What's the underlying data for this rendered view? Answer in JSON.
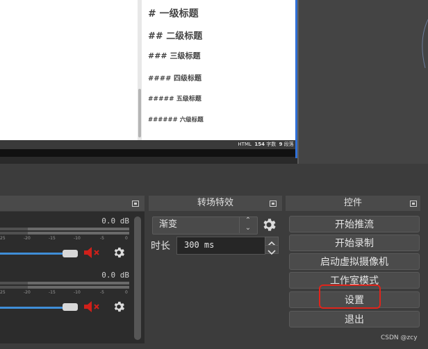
{
  "preview": {
    "headings": [
      "# 一级标题",
      "## 二级标题",
      "### 三级标题",
      "#### 四级标题",
      "##### 五级标题",
      "###### 六级标题"
    ],
    "status": {
      "format": "HTML",
      "char_count": "154",
      "char_label": "字数",
      "para_count": "9",
      "para_label": "段落"
    }
  },
  "mixer": {
    "channels": [
      {
        "db": "0.0 dB",
        "volume": 1.0
      },
      {
        "db": "0.0 dB",
        "volume": 1.0
      }
    ],
    "scale_ticks": [
      "25",
      "-20",
      "-15",
      "-10",
      "-5",
      "0"
    ]
  },
  "transitions": {
    "title": "转场特效",
    "selected": "渐变",
    "duration_label": "时长",
    "duration_value": "300 ms"
  },
  "controls": {
    "title": "控件",
    "buttons": [
      "开始推流",
      "开始录制",
      "启动虚拟摄像机",
      "工作室模式",
      "设置",
      "退出"
    ]
  },
  "watermark": "CSDN @zcy",
  "colors": {
    "accent_blue": "#3f8ed8",
    "mute_red": "#d0201a",
    "highlight_red": "#e0241b"
  }
}
